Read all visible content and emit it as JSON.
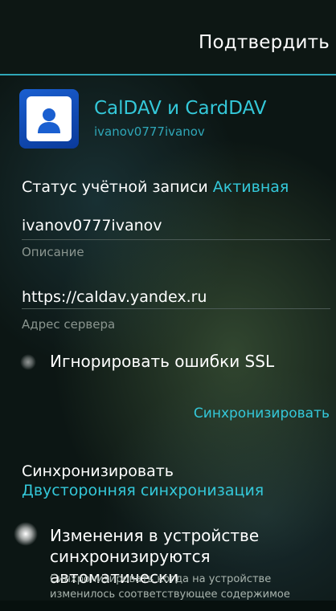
{
  "header": {
    "confirm_label": "Подтвердить"
  },
  "account": {
    "title": "CalDAV и CardDAV",
    "subtitle": "ivanov0777ivanov",
    "icon": "contact-person-icon",
    "status_label": "Статус учётной записи",
    "status_value": "Активная"
  },
  "fields": {
    "description": {
      "value": "ivanov0777ivanov",
      "label": "Описание"
    },
    "server": {
      "value": "https://caldav.yandex.ru",
      "label": "Адрес сервера"
    }
  },
  "ssl": {
    "label": "Игнорировать ошибки SSL",
    "checked": false
  },
  "sync": {
    "link_label": "Синхронизировать",
    "title": "Синхронизировать",
    "mode": "Двусторонняя синхронизация"
  },
  "auto_sync": {
    "label": "Изменения в устройстве синхронизируются автоматически",
    "description": "Синхронизировать когда на устройстве изменилось соответствующее содержимое",
    "checked": true
  },
  "colors": {
    "accent": "#34c8d9",
    "header_separator": "#2fa7b8",
    "background": "#0c1614"
  }
}
